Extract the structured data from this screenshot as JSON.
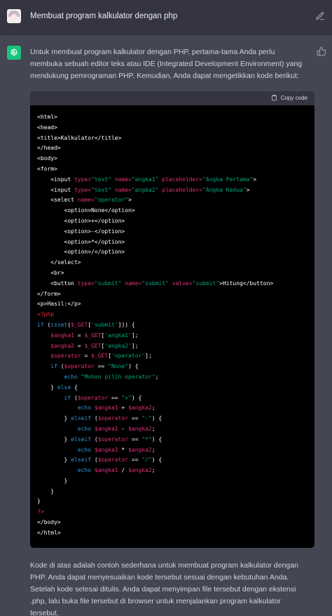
{
  "user_message": {
    "text": "Membuat program kalkulator dengan php"
  },
  "assistant": {
    "intro": "Untuk membuat program kalkulator dengan PHP, pertama-tama Anda perlu membuka sebuah editor teks atau IDE (Integrated Development Environment) yang mendukung pemrograman PHP. Kemudian, Anda dapat mengetikkan kode berikut:",
    "copy_label": "Copy code",
    "outro": "Kode di atas adalah contoh sederhana untuk membuat program kalkulator dengan PHP. Anda dapat menyesuaikan kode tersebut sesuai dengan kebutuhan Anda. Setelah kode selesai ditulis. Anda dapat menyimpan file tersebut dengan ekstensi .php, lalu buka file tersebut di browser untuk menjalankan program kalkulator tersebut."
  },
  "code_lines": [
    [
      [
        "t",
        "<html>"
      ]
    ],
    [
      [
        "t",
        "<head>"
      ]
    ],
    [
      [
        "t",
        "<title>Kalkulator</title>"
      ]
    ],
    [
      [
        "t",
        "</head>"
      ]
    ],
    [
      [
        "t",
        "<body>"
      ]
    ],
    [
      [
        "t",
        "<form>"
      ]
    ],
    [
      [
        "t",
        "    <input "
      ],
      [
        "a",
        "type="
      ],
      [
        "s",
        "\"text\""
      ],
      [
        "t",
        " "
      ],
      [
        "a",
        "name="
      ],
      [
        "s",
        "\"angka1\""
      ],
      [
        "t",
        " "
      ],
      [
        "a",
        "placeholder="
      ],
      [
        "s",
        "\"Angka Pertama\""
      ],
      [
        "t",
        ">"
      ]
    ],
    [
      [
        "t",
        "    <input "
      ],
      [
        "a",
        "type="
      ],
      [
        "s",
        "\"text\""
      ],
      [
        "t",
        " "
      ],
      [
        "a",
        "name="
      ],
      [
        "s",
        "\"angka2\""
      ],
      [
        "t",
        " "
      ],
      [
        "a",
        "placeholder="
      ],
      [
        "s",
        "\"Angka Kedua\""
      ],
      [
        "t",
        ">"
      ]
    ],
    [
      [
        "t",
        "    <select "
      ],
      [
        "a",
        "name="
      ],
      [
        "s",
        "\"operator\""
      ],
      [
        "t",
        ">"
      ]
    ],
    [
      [
        "t",
        "        <option>None</option>"
      ]
    ],
    [
      [
        "t",
        "        <option>+</option>"
      ]
    ],
    [
      [
        "t",
        "        <option>-</option>"
      ]
    ],
    [
      [
        "t",
        "        <option>*</option>"
      ]
    ],
    [
      [
        "t",
        "        <option>/</option>"
      ]
    ],
    [
      [
        "t",
        "    </select>"
      ]
    ],
    [
      [
        "t",
        "    <br>"
      ]
    ],
    [
      [
        "t",
        "    <button "
      ],
      [
        "a",
        "type="
      ],
      [
        "s",
        "\"submit\""
      ],
      [
        "t",
        " "
      ],
      [
        "a",
        "name="
      ],
      [
        "s",
        "\"submit\""
      ],
      [
        "t",
        " "
      ],
      [
        "a",
        "value="
      ],
      [
        "s",
        "\"submit\""
      ],
      [
        "t",
        ">Hitung</button>"
      ]
    ],
    [
      [
        "t",
        "</form>"
      ]
    ],
    [
      [
        "t",
        "<p>Hasil:</p>"
      ]
    ],
    [
      [
        "p",
        "<?php"
      ]
    ],
    [
      [
        "k",
        "if"
      ],
      [
        "t",
        " ("
      ],
      [
        "k",
        "isset"
      ],
      [
        "t",
        "("
      ],
      [
        "v",
        "$_GET"
      ],
      [
        "t",
        "["
      ],
      [
        "s",
        "'submit'"
      ],
      [
        "t",
        "])) {"
      ]
    ],
    [
      [
        "v",
        "    $angka1"
      ],
      [
        "t",
        " = "
      ],
      [
        "v",
        "$_GET"
      ],
      [
        "t",
        "["
      ],
      [
        "s",
        "'angka1'"
      ],
      [
        "t",
        "];"
      ]
    ],
    [
      [
        "v",
        "    $angka2"
      ],
      [
        "t",
        " = "
      ],
      [
        "v",
        "$_GET"
      ],
      [
        "t",
        "["
      ],
      [
        "s",
        "'angka2'"
      ],
      [
        "t",
        "];"
      ]
    ],
    [
      [
        "v",
        "    $operator"
      ],
      [
        "t",
        " = "
      ],
      [
        "v",
        "$_GET"
      ],
      [
        "t",
        "["
      ],
      [
        "s",
        "'operator'"
      ],
      [
        "t",
        "];"
      ]
    ],
    [
      [
        "k",
        "    if"
      ],
      [
        "t",
        " ("
      ],
      [
        "v",
        "$operator"
      ],
      [
        "t",
        " == "
      ],
      [
        "s",
        "\"None\""
      ],
      [
        "t",
        ") {"
      ]
    ],
    [
      [
        "k",
        "        echo"
      ],
      [
        "t",
        " "
      ],
      [
        "s",
        "\"Mohon pilih operator\""
      ],
      [
        "t",
        ";"
      ]
    ],
    [
      [
        "t",
        "    } "
      ],
      [
        "k",
        "else"
      ],
      [
        "t",
        " {"
      ]
    ],
    [
      [
        "k",
        "        if"
      ],
      [
        "t",
        " ("
      ],
      [
        "v",
        "$operator"
      ],
      [
        "t",
        " == "
      ],
      [
        "s",
        "\"+\""
      ],
      [
        "t",
        ") {"
      ]
    ],
    [
      [
        "k",
        "            echo"
      ],
      [
        "t",
        " "
      ],
      [
        "v",
        "$angka1"
      ],
      [
        "t",
        " + "
      ],
      [
        "v",
        "$angka2"
      ],
      [
        "t",
        ";"
      ]
    ],
    [
      [
        "t",
        "        } "
      ],
      [
        "k",
        "elseif"
      ],
      [
        "t",
        " ("
      ],
      [
        "v",
        "$operator"
      ],
      [
        "t",
        " == "
      ],
      [
        "s",
        "\"-\""
      ],
      [
        "t",
        ") {"
      ]
    ],
    [
      [
        "k",
        "            echo"
      ],
      [
        "t",
        " "
      ],
      [
        "v",
        "$angka1"
      ],
      [
        "t",
        " - "
      ],
      [
        "v",
        "$angka2"
      ],
      [
        "t",
        ";"
      ]
    ],
    [
      [
        "t",
        "        } "
      ],
      [
        "k",
        "elseif"
      ],
      [
        "t",
        " ("
      ],
      [
        "v",
        "$operator"
      ],
      [
        "t",
        " == "
      ],
      [
        "s",
        "\"*\""
      ],
      [
        "t",
        ") {"
      ]
    ],
    [
      [
        "k",
        "            echo"
      ],
      [
        "t",
        " "
      ],
      [
        "v",
        "$angka1"
      ],
      [
        "t",
        " * "
      ],
      [
        "v",
        "$angka2"
      ],
      [
        "t",
        ";"
      ]
    ],
    [
      [
        "t",
        "        } "
      ],
      [
        "k",
        "elseif"
      ],
      [
        "t",
        " ("
      ],
      [
        "v",
        "$operator"
      ],
      [
        "t",
        " == "
      ],
      [
        "s",
        "\"/\""
      ],
      [
        "t",
        ") {"
      ]
    ],
    [
      [
        "k",
        "            echo"
      ],
      [
        "t",
        " "
      ],
      [
        "v",
        "$angka1"
      ],
      [
        "t",
        " / "
      ],
      [
        "v",
        "$angka2"
      ],
      [
        "t",
        ";"
      ]
    ],
    [
      [
        "t",
        "        }"
      ]
    ],
    [
      [
        "t",
        "    }"
      ]
    ],
    [
      [
        "t",
        "}"
      ]
    ],
    [
      [
        "p",
        "?>"
      ]
    ],
    [
      [
        "t",
        "</body>"
      ]
    ],
    [
      [
        "t",
        "</html>"
      ]
    ]
  ]
}
